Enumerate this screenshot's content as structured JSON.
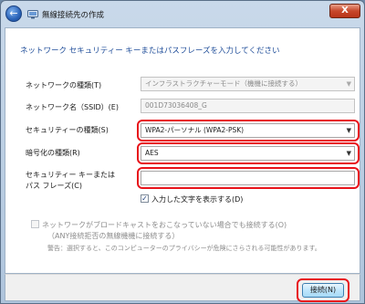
{
  "window": {
    "title": "無線接続先の作成",
    "close_label": "X",
    "back_icon": "back-arrow-icon"
  },
  "main": {
    "heading": "ネットワーク セキュリティー キーまたはパスフレーズを入力してください",
    "network_type": {
      "label": "ネットワークの種類(T)",
      "value": "インフラストラクチャーモード（機機に接続する）"
    },
    "network_name": {
      "label": "ネットワーク名（SSID）(E)",
      "value": "001D73036408_G"
    },
    "security_type": {
      "label": "セキュリティーの種類(S)",
      "value": "WPA2-パーソナル (WPA2-PSK)"
    },
    "encryption_type": {
      "label": "暗号化の種類(R)",
      "value": "AES"
    },
    "security_key": {
      "label_line1": "セキュリティー キーまたは",
      "label_line2": "パス フレーズ(C)",
      "value": ""
    },
    "show_chars": {
      "label": "入力した文字を表示する(D)",
      "checked": true
    },
    "broadcast": {
      "line1": "ネットワークがブロードキャストをおこなっていない場合でも接続する(O)",
      "line2": "（ANY接続拒否の無線機機に接続する）",
      "warning": "警告：選択すると、このコンピューターのプライバシーが危険にさらされる可能性があります。",
      "checked": false
    }
  },
  "footer": {
    "connect_label": "接続(N)"
  },
  "colors": {
    "highlight": "#e8141b",
    "heading": "#1f4d99"
  }
}
